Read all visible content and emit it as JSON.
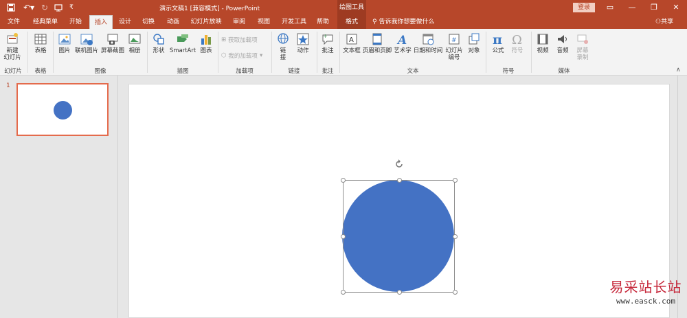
{
  "window": {
    "title": "演示文稿1 [兼容模式] - PowerPoint",
    "context_tool": "绘图工具",
    "login_label": "登录",
    "share_label": "共享"
  },
  "tabs": [
    "文件",
    "经典菜单",
    "开始",
    "插入",
    "设计",
    "切换",
    "动画",
    "幻灯片放映",
    "审阅",
    "视图",
    "开发工具",
    "帮助",
    "格式"
  ],
  "active_tab": "插入",
  "tell_me": "告诉我你想要做什么",
  "ribbon": {
    "new_slide": "新建\n幻灯片",
    "table": "表格",
    "picture": "图片",
    "online_picture": "联机图片",
    "screenshot": "屏幕截图",
    "album": "相册",
    "shapes": "形状",
    "smartart": "SmartArt",
    "chart": "图表",
    "get_addins": "获取加载项",
    "my_addins": "我的加载项",
    "link": "链\n接",
    "action": "动作",
    "comment": "批注",
    "textbox": "文本框",
    "header_footer": "页眉和页脚",
    "wordart": "艺术字",
    "datetime": "日期和时间",
    "slide_number": "幻灯片\n编号",
    "object": "对象",
    "equation": "公式",
    "symbol": "符号",
    "video": "视频",
    "audio": "音频",
    "screen_record": "屏幕\n录制"
  },
  "groups": {
    "slides": "幻灯片",
    "tables": "表格",
    "images": "图像",
    "illustrations": "插图",
    "addins": "加载项",
    "links": "链接",
    "comments": "批注",
    "text": "文本",
    "symbols": "符号",
    "media": "媒体"
  },
  "slides_panel": {
    "slide_number": "1"
  },
  "watermark": {
    "line1": "易采站长站",
    "line2": "www.easck.com"
  },
  "colors": {
    "accent": "#b7472a",
    "shape_fill": "#4472c4",
    "selection": "#e46b4c"
  }
}
